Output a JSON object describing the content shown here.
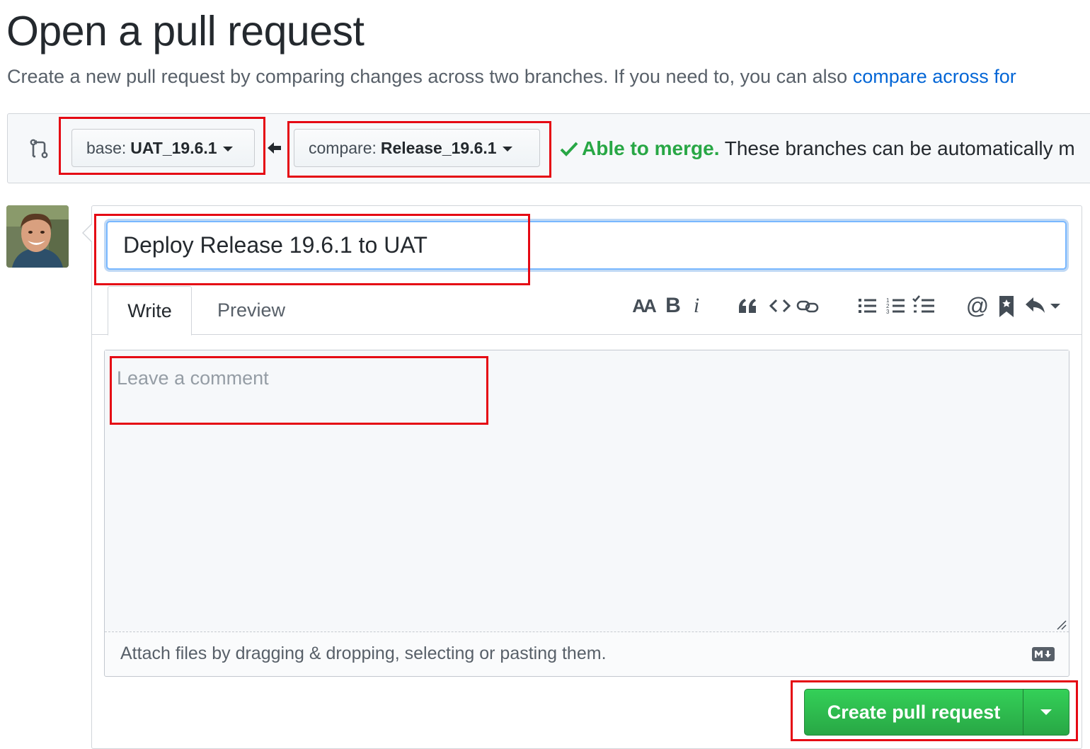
{
  "header": {
    "title": "Open a pull request",
    "subtitle_text": "Create a new pull request by comparing changes across two branches. If you need to, you can also ",
    "subtitle_link": "compare across for"
  },
  "range": {
    "base_label": "base:",
    "base_value": "UAT_19.6.1",
    "compare_label": "compare:",
    "compare_value": "Release_19.6.1",
    "merge_ok": "Able to merge.",
    "merge_desc": " These branches can be automatically m"
  },
  "form": {
    "title_value": "Deploy Release 19.6.1 to UAT",
    "tabs": [
      {
        "label": "Write"
      },
      {
        "label": "Preview"
      }
    ],
    "toolbar": {
      "heading": "AA",
      "bold": "B",
      "italic": "i",
      "quote": "66",
      "mention": "@"
    },
    "comment_placeholder": "Leave a comment",
    "attach_hint": "Attach files by dragging & dropping, selecting or pasting them.",
    "submit_label": "Create pull request"
  },
  "colors": {
    "link": "#0366d6",
    "success": "#28a745",
    "primary_button": "#2ea44f",
    "highlight": "#e50914"
  },
  "icons": [
    "git-compare-icon",
    "arrow-left-icon",
    "check-icon",
    "heading-icon",
    "bold-icon",
    "italic-icon",
    "quote-icon",
    "code-icon",
    "link-icon",
    "unordered-list-icon",
    "ordered-list-icon",
    "task-list-icon",
    "mention-icon",
    "saved-reply-icon",
    "reply-icon",
    "markdown-icon"
  ]
}
